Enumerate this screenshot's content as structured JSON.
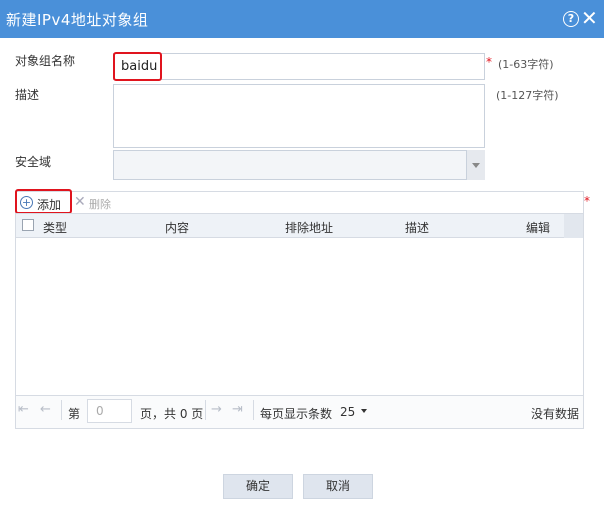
{
  "dialog": {
    "title": "新建IPv4地址对象组",
    "help_icon": "question-circle-icon",
    "close_icon": "close-icon"
  },
  "form": {
    "name_label": "对象组名称",
    "name_value": "baidu",
    "name_required_mark": "*",
    "name_hint": "(1-63字符)",
    "desc_label": "描述",
    "desc_value": "",
    "desc_hint": "(1-127字符)",
    "zone_label": "安全域",
    "zone_value": ""
  },
  "toolbar": {
    "add_label": "添加",
    "delete_label": "删除",
    "required_mark": "*"
  },
  "table": {
    "columns": [
      "类型",
      "内容",
      "排除地址",
      "描述",
      "编辑"
    ],
    "rows": []
  },
  "pager": {
    "page_prefix": "第",
    "page_value": "0",
    "page_suffix": "页，共 0 页",
    "per_page_label": "每页显示条数",
    "per_page_value": "25",
    "no_data": "没有数据"
  },
  "buttons": {
    "confirm": "确定",
    "cancel": "取消"
  },
  "colors": {
    "titlebar": "#4a90d9",
    "highlight": "#e0141e"
  }
}
